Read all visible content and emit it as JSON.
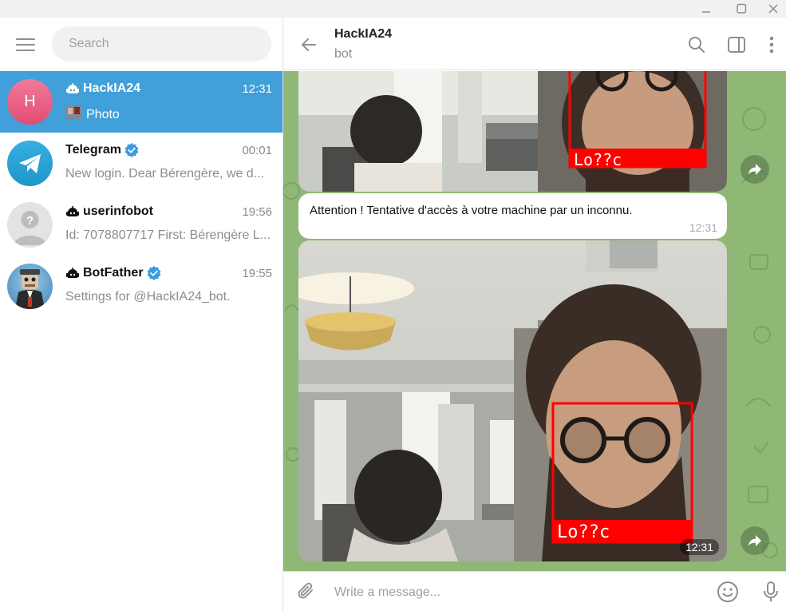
{
  "sidebar": {
    "search_placeholder": "Search",
    "chats": [
      {
        "name": "HackIA24",
        "time": "12:31",
        "preview": "Photo",
        "avatar_letter": "H",
        "avatar_color": "#e8567d",
        "bot": true,
        "verified": false,
        "active": true
      },
      {
        "name": "Telegram",
        "time": "00:01",
        "preview": "New login. Dear Bérengère, we d...",
        "avatar_color": "#2aa3e0",
        "bot": false,
        "verified": true,
        "active": false
      },
      {
        "name": "userinfobot",
        "time": "19:56",
        "preview": "Id: 7078807717 First: Bérengère L...",
        "avatar_color": "#c8c8c8",
        "bot": true,
        "verified": false,
        "active": false
      },
      {
        "name": "BotFather",
        "time": "19:55",
        "preview": "Settings for @HackIA24_bot.",
        "avatar_color": "#4a90c2",
        "bot": true,
        "verified": true,
        "active": false
      }
    ]
  },
  "chat": {
    "title": "HackIA24",
    "subtitle": "bot",
    "messages": [
      {
        "type": "photo",
        "label": "Lo??c"
      },
      {
        "type": "text",
        "text": "Attention ! Tentative d'accès à votre machine par un inconnu.",
        "time": "12:31"
      },
      {
        "type": "photo",
        "label": "Lo??c",
        "time": "12:31"
      }
    ],
    "composer_placeholder": "Write a message..."
  },
  "colors": {
    "accent": "#419fd9",
    "chat_background": "#8fb876",
    "verified": "#3a9be0",
    "face_box": "#ff0000"
  }
}
